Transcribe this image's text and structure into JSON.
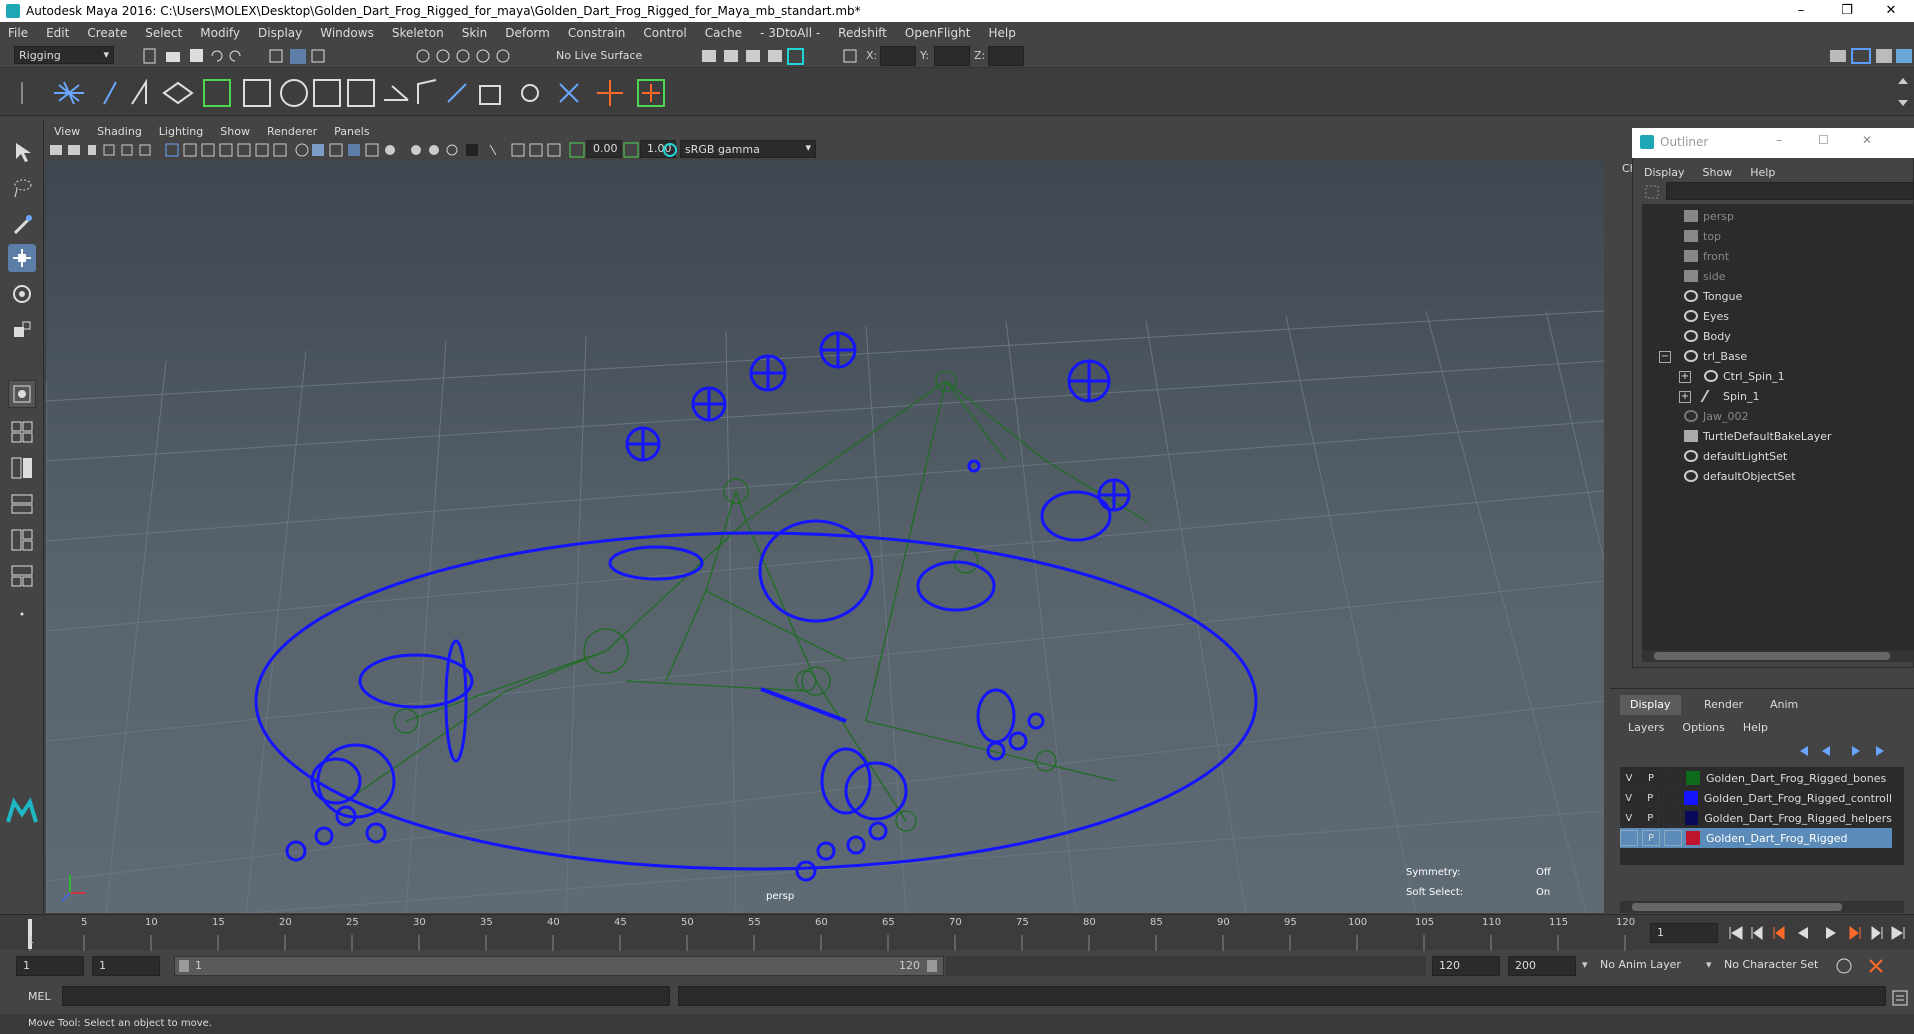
{
  "window": {
    "title": "Autodesk Maya 2016: C:\\Users\\MOLEX\\Desktop\\Golden_Dart_Frog_Rigged_for_maya\\Golden_Dart_Frog_Rigged_for_Maya_mb_standart.mb*",
    "min": "–",
    "max": "❐",
    "close": "✕"
  },
  "menu": [
    "File",
    "Edit",
    "Create",
    "Select",
    "Modify",
    "Display",
    "Windows",
    "Skeleton",
    "Skin",
    "Deform",
    "Constrain",
    "Control",
    "Cache",
    "- 3DtoAll -",
    "Redshift",
    "OpenFlight",
    "Help"
  ],
  "shelf": {
    "mode": "Rigging",
    "live_surface": "No Live Surface",
    "x_label": "X:",
    "y_label": "Y:",
    "z_label": "Z:"
  },
  "viewport": {
    "menu": [
      "View",
      "Shading",
      "Lighting",
      "Show",
      "Renderer",
      "Panels"
    ],
    "field_a": "0.00",
    "field_b": "1.00",
    "color_space": "sRGB gamma",
    "camera_label": "persp",
    "symmetry_label": "Symmetry:",
    "symmetry_value": "Off",
    "soft_select_label": "Soft Select:",
    "soft_select_value": "On"
  },
  "outliner": {
    "title": "Outliner",
    "side_tab": "Ch",
    "menu": [
      "Display",
      "Show",
      "Help"
    ],
    "items": [
      {
        "label": "persp",
        "dim": true
      },
      {
        "label": "top",
        "dim": true
      },
      {
        "label": "front",
        "dim": true
      },
      {
        "label": "side",
        "dim": true
      },
      {
        "label": "Tongue",
        "dim": false
      },
      {
        "label": "Eyes",
        "dim": false
      },
      {
        "label": "Body",
        "dim": false
      },
      {
        "label": "trl_Base",
        "dim": false
      },
      {
        "label": "Ctrl_Spin_1",
        "dim": false
      },
      {
        "label": "Spin_1",
        "dim": false
      },
      {
        "label": "Jaw_002",
        "dim": true
      },
      {
        "label": "TurtleDefaultBakeLayer",
        "dim": false
      },
      {
        "label": "defaultLightSet",
        "dim": false
      },
      {
        "label": "defaultObjectSet",
        "dim": false
      }
    ]
  },
  "layers": {
    "tabs": [
      "Display",
      "Render",
      "Anim"
    ],
    "menu": [
      "Layers",
      "Options",
      "Help"
    ],
    "rows": [
      {
        "v": "V",
        "p": "P",
        "name": "Golden_Dart_Frog_Rigged_bones",
        "color": "#0f6b1c"
      },
      {
        "v": "V",
        "p": "P",
        "name": "Golden_Dart_Frog_Rigged_controll",
        "color": "#1414ff"
      },
      {
        "v": "V",
        "p": "P",
        "name": "Golden_Dart_Frog_Rigged_helpers",
        "color": "#0a0a5a"
      },
      {
        "v": "",
        "p": "P",
        "name": "Golden_Dart_Frog_Rigged",
        "color": "#c0142e"
      }
    ]
  },
  "timeline": {
    "ticks": [
      "5",
      "10",
      "15",
      "20",
      "25",
      "30",
      "35",
      "40",
      "45",
      "50",
      "55",
      "60",
      "65",
      "70",
      "75",
      "80",
      "85",
      "90",
      "95",
      "100",
      "105",
      "110",
      "115",
      "120"
    ],
    "start_tick": "1",
    "current_frame": "1"
  },
  "range": {
    "start": "1",
    "playback_start": "1",
    "slider_start": "1",
    "slider_end": "120",
    "playback_end": "120",
    "end": "200",
    "anim_layer": "No Anim Layer",
    "char_set": "No Character Set"
  },
  "cmd": {
    "label": "MEL"
  },
  "help": "Move Tool: Select an object to move."
}
